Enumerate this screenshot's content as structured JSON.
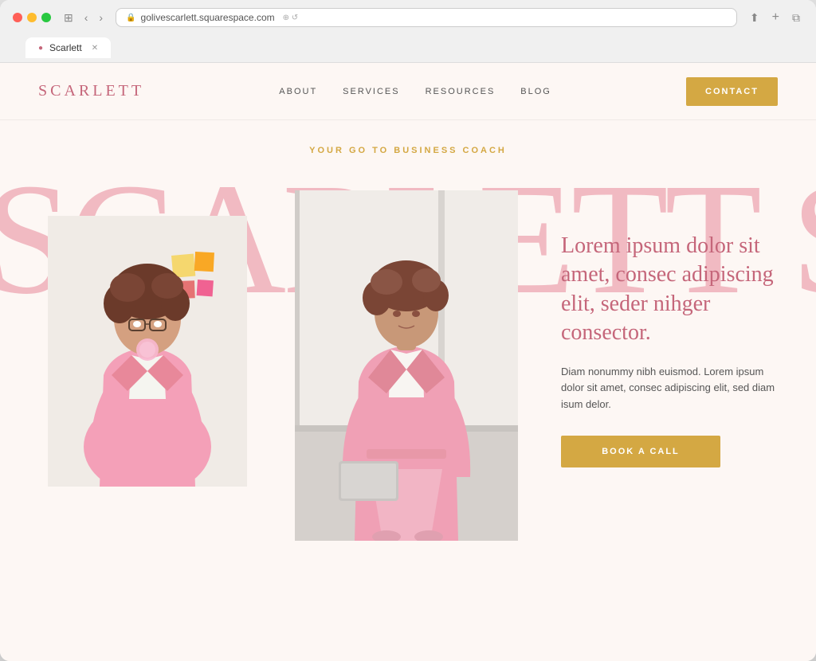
{
  "browser": {
    "url": "golivescarlett.squarespace.com",
    "tab_label": "Scarlett"
  },
  "nav": {
    "logo": "SCARLETT",
    "links": [
      "ABOUT",
      "SERVICES",
      "RESOURCES",
      "BLOG"
    ],
    "contact_label": "CONTACT"
  },
  "hero": {
    "subtitle": "YOUR GO TO BUSINESS COACH",
    "bg_text": "SCARLETT",
    "headline": "Lorem ipsum dolor sit amet, consec adipiscing elit, seder nihger consector.",
    "body_text": "Diam nonummy nibh euismod. Lorem ipsum dolor sit amet, consec adipiscing elit, sed diam isum delor.",
    "cta_label": "BOOK A CALL"
  },
  "colors": {
    "brand_pink": "#c5667a",
    "brand_gold": "#d4a843",
    "bg": "#fdf7f4",
    "text_dark": "#555555"
  }
}
